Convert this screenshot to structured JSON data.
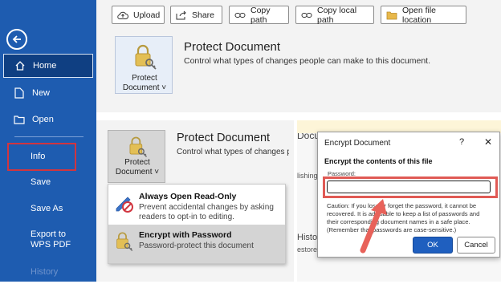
{
  "sidebar": {
    "items": [
      {
        "label": "Home"
      },
      {
        "label": "New"
      },
      {
        "label": "Open"
      },
      {
        "label": "Info"
      },
      {
        "label": "Save"
      },
      {
        "label": "Save As"
      },
      {
        "label": "Export to WPS PDF"
      },
      {
        "label": "History"
      }
    ]
  },
  "toolbar": {
    "upload": "Upload",
    "share": "Share",
    "copy_path": "Copy path",
    "copy_local_path": "Copy local path",
    "open_file_location": "Open file location"
  },
  "protect_panel": {
    "button_label": "Protect Document ˅",
    "title": "Protect Document",
    "description": "Control what types of changes people can make to this document."
  },
  "protect_panel_zoomed": {
    "button_label": "Protect Document ˅",
    "title": "Protect Document",
    "description": "Control what types of changes pe"
  },
  "protect_menu": {
    "items": [
      {
        "title": "Always Open Read-Only",
        "description": "Prevent accidental changes by asking readers to opt-in to editing."
      },
      {
        "title": "Encrypt with Password",
        "description": "Password-protect this document"
      }
    ]
  },
  "background_panel": {
    "text1": "Documen",
    "text2": "lishing",
    "text3": "History",
    "text4": "estore p"
  },
  "dialog": {
    "title": "Encrypt Document",
    "help": "?",
    "close": "✕",
    "heading": "Encrypt the contents of this file",
    "password_label": "Password:",
    "password_value": "",
    "caution": "Caution: If you lose or forget the password, it cannot be recovered. It is advisable to keep a list of passwords and their corresponding document names in a safe place. (Remember that passwords are case-sensitive.)",
    "ok": "OK",
    "cancel": "Cancel"
  },
  "colors": {
    "sidebar": "#1e5cb0",
    "highlight": "#d1353f",
    "arrow": "#e8625a",
    "ok_button": "#1f5fbf"
  }
}
